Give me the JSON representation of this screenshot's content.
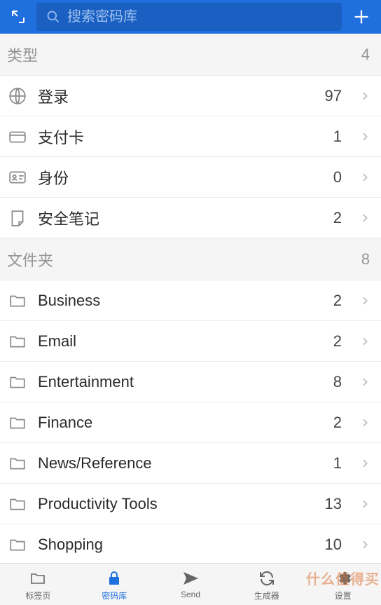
{
  "header": {
    "search_placeholder": "搜索密码库"
  },
  "sections": {
    "types": {
      "title": "类型",
      "count": 4
    },
    "folders": {
      "title": "文件夹",
      "count": 8
    }
  },
  "types": [
    {
      "label": "登录",
      "count": 97,
      "icon": "globe"
    },
    {
      "label": "支付卡",
      "count": 1,
      "icon": "card"
    },
    {
      "label": "身份",
      "count": 0,
      "icon": "identity"
    },
    {
      "label": "安全笔记",
      "count": 2,
      "icon": "note"
    }
  ],
  "folders": [
    {
      "label": "Business",
      "count": 2
    },
    {
      "label": "Email",
      "count": 2
    },
    {
      "label": "Entertainment",
      "count": 8
    },
    {
      "label": "Finance",
      "count": 2
    },
    {
      "label": "News/Reference",
      "count": 1
    },
    {
      "label": "Productivity Tools",
      "count": 13
    },
    {
      "label": "Shopping",
      "count": 10
    }
  ],
  "nav": [
    {
      "label": "标签页",
      "icon": "folder"
    },
    {
      "label": "密码库",
      "icon": "lock"
    },
    {
      "label": "Send",
      "icon": "send"
    },
    {
      "label": "生成器",
      "icon": "refresh"
    },
    {
      "label": "设置",
      "icon": "gear"
    }
  ],
  "watermark": "什么值得买"
}
